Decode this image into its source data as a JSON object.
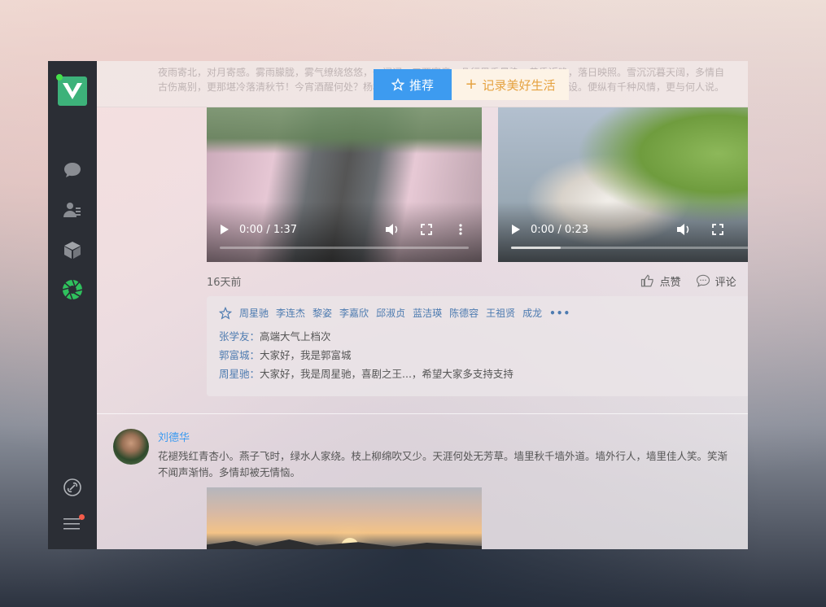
{
  "topbar": {
    "faded_text": "夜雨寄北，对月寄感。雾雨朦胧，雾气缭绕悠悠，一阙词，三两寒意，几行墨香晕染。黄昏近晚，落日映照。雪沉沉暮天阔，多情自古伤离别，更那堪冷落清秋节！今宵酒醒何处？杨柳岸，晓风残月。此去经年，应是良辰好景虚设。便纵有千种风情，更与何人说。",
    "tab_recommend": "推荐",
    "tab_record": "记录美好生活"
  },
  "colors": {
    "primary": "#3d9bf0",
    "accent": "#e5a240",
    "sidebar": "#2b2e35",
    "logo": "#3db27a"
  },
  "sidebar": {
    "icons": [
      "chat-icon",
      "contacts-icon",
      "cube-icon",
      "aperture-icon"
    ],
    "bottom_icons": [
      "link-icon",
      "menu-icon"
    ]
  },
  "videos": [
    {
      "time": "0:00 / 1:37",
      "progress": 0
    },
    {
      "time": "0:00 / 0:23",
      "progress": 0.2
    }
  ],
  "post1": {
    "time_ago": "16天前",
    "like_label": "点赞",
    "comment_label": "评论",
    "likers": [
      "周星驰",
      "李连杰",
      "黎姿",
      "李嘉欣",
      "邱淑贞",
      "蓝洁瑛",
      "陈德容",
      "王祖贤",
      "成龙"
    ],
    "comments": [
      {
        "name": "张学友：",
        "text": "高端大气上档次"
      },
      {
        "name": "郭富城：",
        "text": "大家好，我是郭富城"
      },
      {
        "name": "周星驰：",
        "text": "大家好，我是周星驰，喜剧之王...，希望大家多支持支持"
      }
    ]
  },
  "post2": {
    "username": "刘德华",
    "text": "花褪残红青杏小。燕子飞时，绿水人家绕。枝上柳绵吹又少。天涯何处无芳草。墙里秋千墙外道。墙外行人，墙里佳人笑。笑渐不闻声渐悄。多情却被无情恼。"
  }
}
